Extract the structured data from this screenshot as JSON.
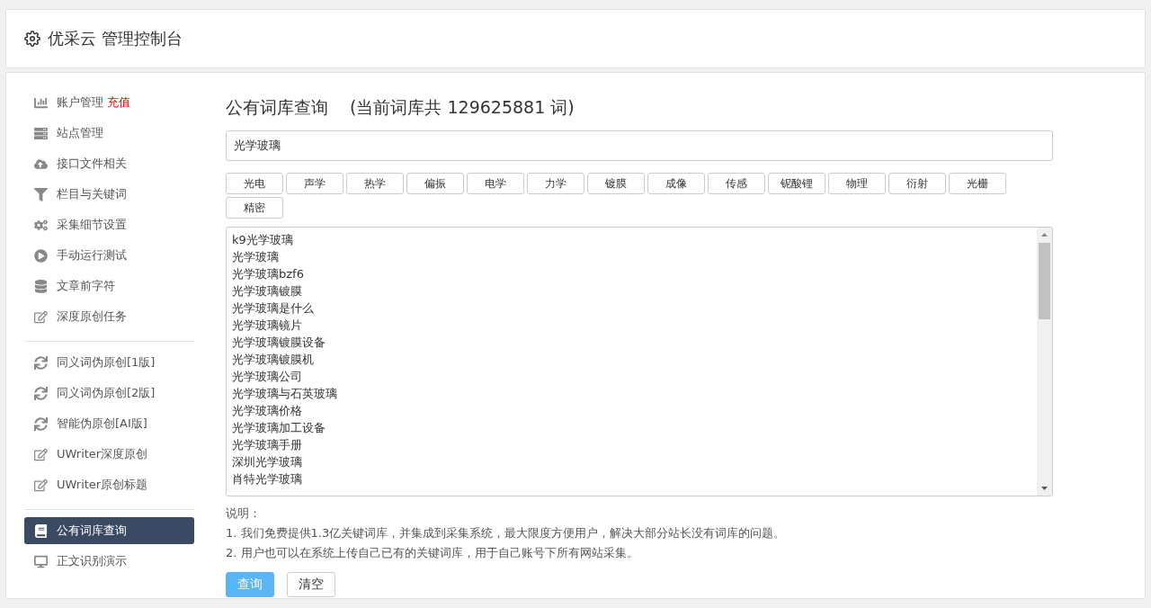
{
  "header": {
    "title": "优采云 管理控制台"
  },
  "sidebar": {
    "groups": [
      [
        {
          "label": "账户管理",
          "badge": "充值",
          "selected": false
        },
        {
          "label": "站点管理",
          "selected": false
        },
        {
          "label": "接口文件相关",
          "selected": false
        },
        {
          "label": "栏目与关键词",
          "selected": false
        },
        {
          "label": "采集细节设置",
          "selected": false
        },
        {
          "label": "手动运行测试",
          "selected": false
        },
        {
          "label": "文章前字符",
          "selected": false
        },
        {
          "label": "深度原创任务",
          "selected": false
        }
      ],
      [
        {
          "label": "同义词伪原创[1版]",
          "selected": false
        },
        {
          "label": "同义词伪原创[2版]",
          "selected": false
        },
        {
          "label": "智能伪原创[AI版]",
          "selected": false
        },
        {
          "label": "UWriter深度原创",
          "selected": false
        },
        {
          "label": "UWriter原创标题",
          "selected": false
        }
      ],
      [
        {
          "label": "公有词库查询",
          "selected": true
        },
        {
          "label": "正文识别演示",
          "selected": false
        }
      ]
    ]
  },
  "main": {
    "title": "公有词库查询",
    "count": "(当前词库共 129625881 词)",
    "search": {
      "value": "光学玻璃"
    },
    "tags": [
      "光电",
      "声学",
      "热学",
      "偏振",
      "电学",
      "力学",
      "镀膜",
      "成像",
      "传感",
      "铌酸锂",
      "物理",
      "衍射",
      "光栅",
      "精密"
    ],
    "results": [
      "k9光学玻璃",
      "光学玻璃",
      "光学玻璃bzf6",
      "光学玻璃镀膜",
      "光学玻璃是什么",
      "光学玻璃镜片",
      "光学玻璃镀膜设备",
      "光学玻璃镀膜机",
      "光学玻璃公司",
      "光学玻璃与石英玻璃",
      "光学玻璃价格",
      "光学玻璃加工设备",
      "光学玻璃手册",
      "深圳光学玻璃",
      "肖特光学玻璃"
    ],
    "notes_label": "说明：",
    "notes": [
      "1. 我们免费提供1.3亿关键词库，并集成到采集系统，最大限度方便用户，解决大部分站长没有词库的问题。",
      "2. 用户也可以在系统上传自己已有的关键词库，用于自己账号下所有网站采集。"
    ],
    "buttons": [
      {
        "label": "查询",
        "kind": "primary"
      },
      {
        "label": "清空",
        "kind": "default"
      }
    ]
  }
}
